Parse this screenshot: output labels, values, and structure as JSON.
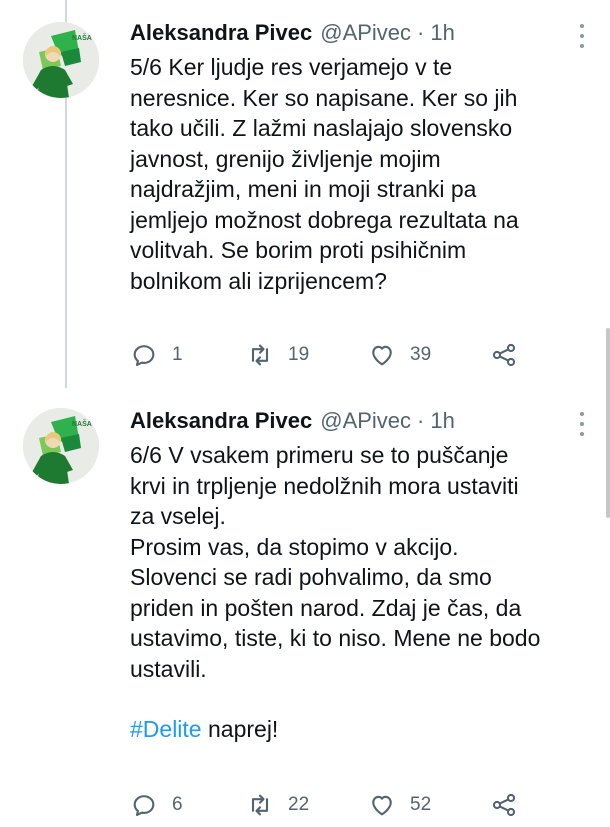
{
  "tweets": [
    {
      "author_name": "Aleksandra Pivec",
      "handle": "@APivec",
      "separator": "·",
      "time": "1h",
      "text": "5/6 Ker ljudje res verjamejo v te\nneresnice. Ker so napisane. Ker so jih\ntako učili. Z lažmi naslajajo slovensko\njavnost, grenijo življenje mojim\nnajdražjim, meni in moji stranki pa\njemljejo možnost dobrega rezultata na\nvolitvah. Se borim proti psihičnim\nbolnikom ali izprijencem?",
      "replies": "1",
      "retweets": "19",
      "likes": "39",
      "avatar_text": "NAŠA DEŽELA"
    },
    {
      "author_name": "Aleksandra Pivec",
      "handle": "@APivec",
      "separator": "·",
      "time": "1h",
      "text": "6/6 V vsakem primeru se to puščanje\nkrvi in trpljenje nedolžnih mora ustaviti\nza vselej.\nProsim vas, da stopimo v akcijo.\nSlovenci se radi pohvalimo, da smo\npriden in pošten narod. Zdaj je čas, da\nustavimo, tiste, ki to niso. Mene ne bodo\nustavili.",
      "hashtag": "#Delite",
      "hashtag_rest": " naprej!",
      "replies": "6",
      "retweets": "22",
      "likes": "52",
      "avatar_text": "NAŠA DEŽELA"
    }
  ],
  "icons": {
    "reply": "reply-icon",
    "retweet": "retweet-icon",
    "like": "heart-icon",
    "share": "share-icon",
    "more": "more-options-icon"
  },
  "colors": {
    "text": "#0f1419",
    "secondary": "#536471",
    "link": "#1d9bf0",
    "thread_line": "#cfd9de",
    "avatar_green": "#1e8b3a"
  }
}
